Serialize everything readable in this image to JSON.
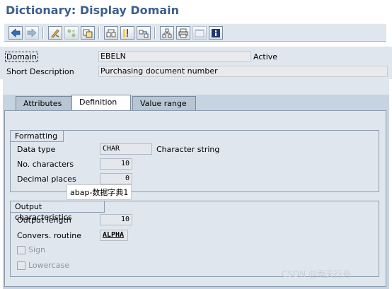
{
  "title": "Dictionary: Display Domain",
  "toolbar": {
    "buttons": [
      {
        "icon": "back-arrow-icon"
      },
      {
        "icon": "forward-arrow-icon"
      },
      {
        "icon": "display-change-icon"
      },
      {
        "icon": "check-icon"
      },
      {
        "icon": "activate-icon"
      },
      {
        "icon": "where-used-icon"
      },
      {
        "icon": "object-list-icon"
      },
      {
        "icon": "navigate-icon"
      },
      {
        "icon": "hierarchy-icon"
      },
      {
        "icon": "print-icon"
      },
      {
        "icon": "window-icon"
      },
      {
        "icon": "info-icon"
      }
    ]
  },
  "header": {
    "domain_label": "Domain",
    "domain_value": "EBELN",
    "status": "Active",
    "short_desc_label": "Short Description",
    "short_desc_value": "Purchasing document number"
  },
  "tabs": [
    {
      "label": "Attributes",
      "active": false
    },
    {
      "label": "Definition",
      "active": true
    },
    {
      "label": "Value range",
      "active": false
    }
  ],
  "formatting": {
    "title": "Formatting",
    "data_type_label": "Data type",
    "data_type_value": "CHAR",
    "data_type_desc": "Character string",
    "no_chars_label": "No. characters",
    "no_chars_value": "10",
    "decimals_label": "Decimal places",
    "decimals_value": "0"
  },
  "output": {
    "title": "Output characteristics",
    "length_label": "Output length",
    "length_value": "10",
    "conv_label": "Convers. routine",
    "conv_value": "ALPHA",
    "sign_label": "Sign",
    "sign_checked": false,
    "lower_label": "Lowercase",
    "lower_checked": false
  },
  "tooltip": "abap-数据字典1",
  "watermark": "CSDN @雨天行舟",
  "colors": {
    "title": "#3a5f8e",
    "panel": "#dfe6ee",
    "tab_strip": "#c6d3e0"
  }
}
